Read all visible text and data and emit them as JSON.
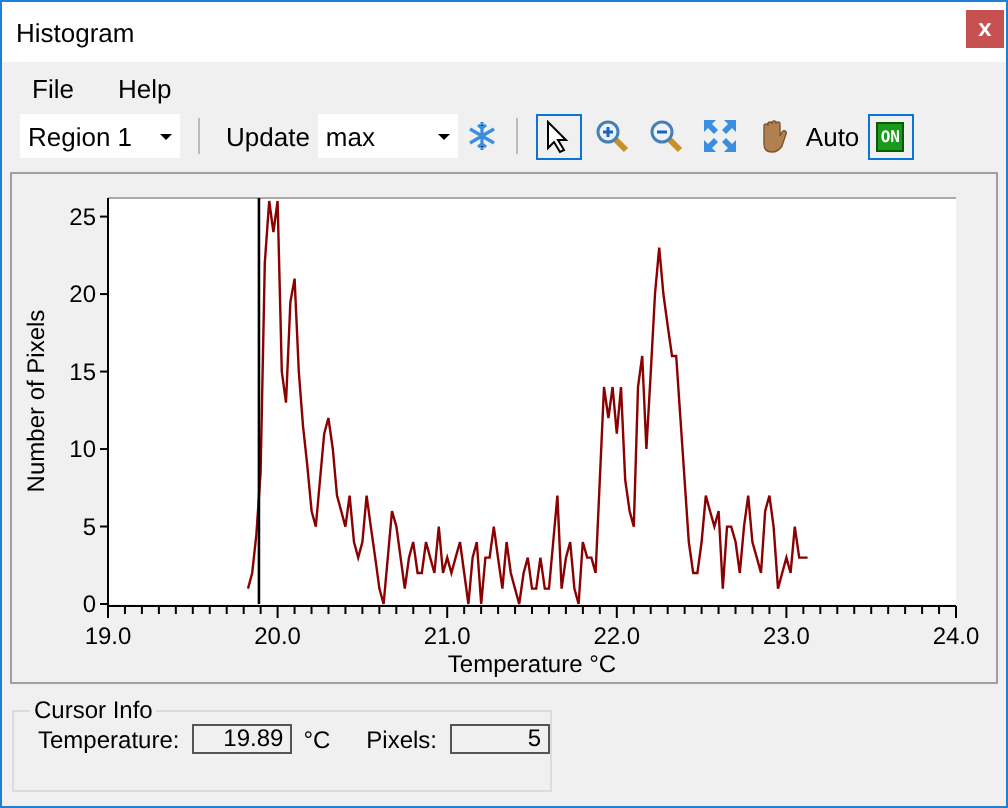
{
  "window": {
    "title": "Histogram",
    "close": "x"
  },
  "menu": [
    "File",
    "Help"
  ],
  "toolbar": {
    "region": "Region 1",
    "update_label": "Update",
    "update_value": "max",
    "tools": [
      {
        "kind": "pointer",
        "selected": true
      },
      {
        "kind": "zoom-in",
        "selected": false
      },
      {
        "kind": "zoom-out",
        "selected": false
      },
      {
        "kind": "fit",
        "selected": false
      },
      {
        "kind": "hand",
        "selected": false
      }
    ],
    "auto_label": "Auto",
    "auto_toggle": {
      "label": "ON",
      "on": true
    }
  },
  "chart_data": {
    "type": "line",
    "xlabel": "Temperature °C",
    "ylabel": "Number of Pixels",
    "xlim": [
      19,
      24
    ],
    "ylim": [
      0,
      26.2
    ],
    "xticks": [
      {
        "value": 19,
        "label": "19.0"
      },
      {
        "value": 20,
        "label": "20.0"
      },
      {
        "value": 21,
        "label": "21.0"
      },
      {
        "value": 22,
        "label": "22.0"
      },
      {
        "value": 23,
        "label": "23.0"
      },
      {
        "value": 24,
        "label": "24.0"
      }
    ],
    "yticks": [
      0,
      5,
      10,
      15,
      20,
      25
    ],
    "ref_lines": [
      {
        "axis": "x",
        "value": 19.89
      }
    ],
    "x": [
      19.825,
      19.85,
      19.875,
      19.9,
      19.925,
      19.95,
      19.975,
      20.0,
      20.025,
      20.05,
      20.075,
      20.1,
      20.125,
      20.15,
      20.175,
      20.2,
      20.225,
      20.25,
      20.275,
      20.3,
      20.325,
      20.35,
      20.375,
      20.4,
      20.425,
      20.45,
      20.475,
      20.5,
      20.525,
      20.55,
      20.575,
      20.6,
      20.625,
      20.65,
      20.675,
      20.7,
      20.725,
      20.75,
      20.775,
      20.8,
      20.825,
      20.85,
      20.875,
      20.9,
      20.925,
      20.95,
      20.975,
      21.0,
      21.025,
      21.05,
      21.075,
      21.1,
      21.125,
      21.15,
      21.175,
      21.2,
      21.225,
      21.25,
      21.275,
      21.3,
      21.325,
      21.35,
      21.375,
      21.4,
      21.425,
      21.45,
      21.475,
      21.5,
      21.525,
      21.55,
      21.575,
      21.6,
      21.625,
      21.65,
      21.675,
      21.7,
      21.725,
      21.75,
      21.775,
      21.8,
      21.825,
      21.85,
      21.875,
      21.9,
      21.925,
      21.95,
      21.975,
      22.0,
      22.025,
      22.05,
      22.075,
      22.1,
      22.125,
      22.15,
      22.175,
      22.2,
      22.225,
      22.25,
      22.275,
      22.3,
      22.325,
      22.35,
      22.375,
      22.4,
      22.425,
      22.45,
      22.475,
      22.5,
      22.525,
      22.55,
      22.575,
      22.6,
      22.625,
      22.65,
      22.675,
      22.7,
      22.725,
      22.75,
      22.775,
      22.8,
      22.825,
      22.85,
      22.875,
      22.9,
      22.925,
      22.95,
      22.975,
      23.0,
      23.025,
      23.05,
      23.075,
      23.1,
      23.125
    ],
    "series": [
      {
        "color": "#8b0000",
        "values": [
          1,
          2,
          4.5,
          8.5,
          22,
          26,
          24,
          26,
          15,
          13,
          19.5,
          21,
          15,
          11.5,
          9,
          6,
          5,
          8,
          11,
          12,
          10,
          7,
          6,
          5,
          7,
          4,
          3,
          4,
          7,
          5,
          3,
          1,
          0,
          3,
          6,
          5,
          3,
          1,
          3,
          4,
          2,
          2,
          4,
          3,
          2,
          5,
          2,
          3,
          2,
          3,
          4,
          2,
          0,
          3,
          4,
          0,
          3,
          3,
          5,
          3,
          1,
          4,
          2,
          1,
          0,
          2,
          3,
          1,
          1,
          3,
          1,
          1,
          4,
          7,
          1,
          3,
          4,
          1,
          0,
          4,
          3,
          3,
          2,
          8,
          14,
          12,
          14,
          11,
          14,
          8,
          6,
          5,
          14,
          16,
          10,
          15,
          20,
          23,
          20,
          18,
          16,
          16,
          12,
          8,
          4,
          2,
          2,
          4,
          7,
          6,
          5,
          6,
          1,
          5,
          5,
          4,
          2,
          5,
          7,
          4,
          3,
          2,
          6,
          7,
          5,
          1,
          2,
          3,
          2,
          5,
          3,
          3,
          3
        ]
      }
    ]
  },
  "cursor_info": {
    "title": "Cursor Info",
    "temperature_label": "Temperature:",
    "temperature": "19.89",
    "unit": "°C",
    "pixels_label": "Pixels:",
    "pixels": "5"
  }
}
